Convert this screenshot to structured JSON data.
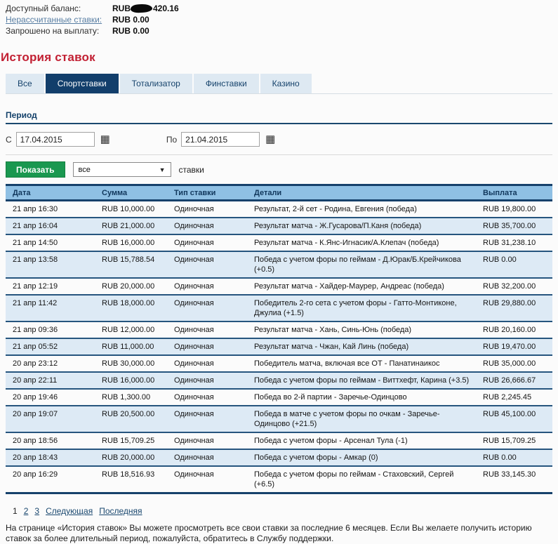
{
  "balance": {
    "rows": [
      {
        "label": "Доступный баланс:",
        "link": false,
        "redacted": true,
        "value_prefix": "RUB",
        "value_suffix": "420.16"
      },
      {
        "label": "Нерассчитанные ставки:",
        "link": true,
        "redacted": false,
        "value": "RUB 0.00"
      },
      {
        "label": "Запрошено на выплату:",
        "link": false,
        "redacted": false,
        "value": "RUB 0.00"
      }
    ]
  },
  "page_title": "История ставок",
  "tabs": [
    {
      "label": "Все",
      "active": false
    },
    {
      "label": "Спортставки",
      "active": true
    },
    {
      "label": "Тотализатор",
      "active": false
    },
    {
      "label": "Финставки",
      "active": false
    },
    {
      "label": "Казино",
      "active": false
    }
  ],
  "period": {
    "heading": "Период",
    "from_label": "С",
    "from_value": "17.04.2015",
    "to_label": "По",
    "to_value": "21.04.2015",
    "calendar_icon": "▦"
  },
  "filter": {
    "show_button": "Показать",
    "select_value": "все",
    "select_arrow": "▼",
    "suffix_label": "ставки"
  },
  "table": {
    "columns": [
      "Дата",
      "Сумма",
      "Тип ставки",
      "Детали",
      "Выплата"
    ],
    "rows": [
      [
        "21 апр 16:30",
        "RUB 10,000.00",
        "Одиночная",
        "Результат, 2-й сет - Родина, Евгения (победа)",
        "RUB 19,800.00"
      ],
      [
        "21 апр 16:04",
        "RUB 21,000.00",
        "Одиночная",
        "Результат матча - Ж.Гусарова/П.Каня (победа)",
        "RUB 35,700.00"
      ],
      [
        "21 апр 14:50",
        "RUB 16,000.00",
        "Одиночная",
        "Результат матча - К.Янс-Игнасик/А.Клепач (победа)",
        "RUB 31,238.10"
      ],
      [
        "21 апр 13:58",
        "RUB 15,788.54",
        "Одиночная",
        "Победа с учетом форы по геймам - Д.Юрак/Б.Крейчикова (+0.5)",
        "RUB 0.00"
      ],
      [
        "21 апр 12:19",
        "RUB 20,000.00",
        "Одиночная",
        "Результат матча - Хайдер-Маурер, Андреас (победа)",
        "RUB 32,200.00"
      ],
      [
        "21 апр 11:42",
        "RUB 18,000.00",
        "Одиночная",
        "Победитель 2-го сета с учетом форы - Гатто-Монтиконе, Джулиа (+1.5)",
        "RUB 29,880.00"
      ],
      [
        "21 апр 09:36",
        "RUB 12,000.00",
        "Одиночная",
        "Результат матча - Хань, Синь-Юнь (победа)",
        "RUB 20,160.00"
      ],
      [
        "21 апр 05:52",
        "RUB 11,000.00",
        "Одиночная",
        "Результат матча - Чжан, Кай Линь (победа)",
        "RUB 19,470.00"
      ],
      [
        "20 апр 23:12",
        "RUB 30,000.00",
        "Одиночная",
        "Победитель матча, включая все ОТ - Панатинаикос",
        "RUB 35,000.00"
      ],
      [
        "20 апр 22:11",
        "RUB 16,000.00",
        "Одиночная",
        "Победа с учетом форы по геймам - Виттхефт, Карина (+3.5)",
        "RUB 26,666.67"
      ],
      [
        "20 апр 19:46",
        "RUB 1,300.00",
        "Одиночная",
        "Победа во 2-й партии - Заречье-Одинцово",
        "RUB 2,245.45"
      ],
      [
        "20 апр 19:07",
        "RUB 20,500.00",
        "Одиночная",
        "Победа в матче с учетом форы по очкам - Заречье-Одинцово (+21.5)",
        "RUB 45,100.00"
      ],
      [
        "20 апр 18:56",
        "RUB 15,709.25",
        "Одиночная",
        "Победа с учетом форы - Арсенал Тула (-1)",
        "RUB 15,709.25"
      ],
      [
        "20 апр 18:43",
        "RUB 20,000.00",
        "Одиночная",
        "Победа с учетом форы - Амкар (0)",
        "RUB 0.00"
      ],
      [
        "20 апр 16:29",
        "RUB 18,516.93",
        "Одиночная",
        "Победа с учетом форы по геймам - Стаховский, Сергей (+6.5)",
        "RUB 33,145.30"
      ]
    ]
  },
  "pagination": {
    "current": "1",
    "links": [
      "2",
      "3",
      "Следующая",
      "Последняя"
    ]
  },
  "footer_text": "На странице «История ставок» Вы можете просмотреть все свои ставки за последние 6 месяцев. Если Вы желаете получить историю ставок за более длительный период, пожалуйста, обратитесь в Службу поддержки.",
  "colors": {
    "accent_navy": "#123e6b",
    "table_header_blue": "#8fc0e4",
    "alt_row_blue": "#ddeaf5",
    "title_red": "#c22033",
    "button_green": "#1a9850",
    "link_blue": "#587ea3"
  }
}
